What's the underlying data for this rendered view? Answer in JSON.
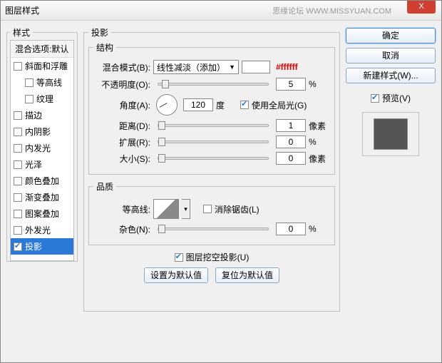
{
  "window": {
    "title": "图层样式",
    "watermark": "思缘论坛 WWW.MISSYUAN.COM",
    "close": "X"
  },
  "left": {
    "heading": "样式",
    "blend_defaults": "混合选项:默认",
    "items": [
      {
        "label": "斜面和浮雕",
        "checked": false,
        "indent": false
      },
      {
        "label": "等高线",
        "checked": false,
        "indent": true
      },
      {
        "label": "纹理",
        "checked": false,
        "indent": true
      },
      {
        "label": "描边",
        "checked": false,
        "indent": false
      },
      {
        "label": "内阴影",
        "checked": false,
        "indent": false
      },
      {
        "label": "内发光",
        "checked": false,
        "indent": false
      },
      {
        "label": "光泽",
        "checked": false,
        "indent": false
      },
      {
        "label": "颜色叠加",
        "checked": false,
        "indent": false
      },
      {
        "label": "渐变叠加",
        "checked": false,
        "indent": false
      },
      {
        "label": "图案叠加",
        "checked": false,
        "indent": false
      },
      {
        "label": "外发光",
        "checked": false,
        "indent": false
      },
      {
        "label": "投影",
        "checked": true,
        "indent": false,
        "selected": true
      }
    ]
  },
  "panel": {
    "title": "投影",
    "structure": {
      "legend": "结构",
      "blend_mode_label": "混合模式(B):",
      "blend_mode_value": "线性减淡（添加）",
      "color_hex": "#ffffff",
      "opacity_label": "不透明度(O):",
      "opacity_value": "5",
      "percent": "%",
      "angle_label": "角度(A):",
      "angle_value": "120",
      "angle_unit": "度",
      "global_light": "使用全局光(G)",
      "distance_label": "距离(D):",
      "distance_value": "1",
      "pixel": "像素",
      "spread_label": "扩展(R):",
      "spread_value": "0",
      "size_label": "大小(S):",
      "size_value": "0"
    },
    "quality": {
      "legend": "品质",
      "contour_label": "等高线:",
      "antialias": "消除锯齿(L)",
      "noise_label": "杂色(N):",
      "noise_value": "0"
    },
    "knockout": "图层挖空投影(U)",
    "set_default": "设置为默认值",
    "reset_default": "复位为默认值"
  },
  "right": {
    "ok": "确定",
    "cancel": "取消",
    "new_style": "新建样式(W)...",
    "preview": "预览(V)"
  }
}
